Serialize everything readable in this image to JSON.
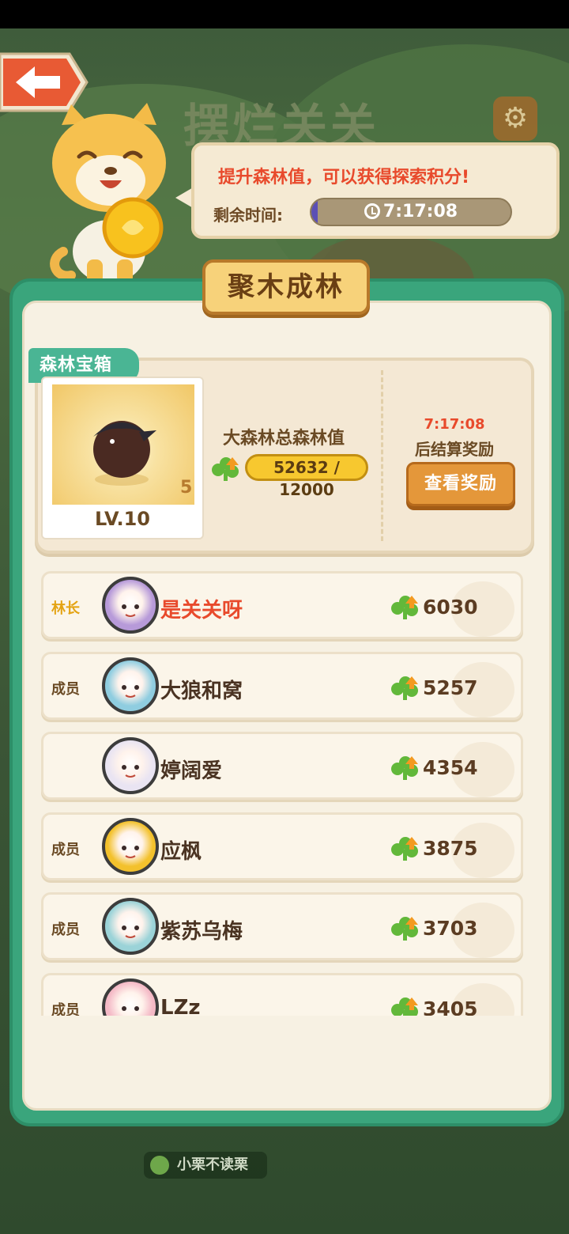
{
  "header": {
    "game_title": "摆烂关关",
    "settings_icon": "gear-icon",
    "back_icon": "arrow-left-icon"
  },
  "bubble": {
    "tip": "提升森林值，可以获得探索积分!",
    "remaining_label": "剩余时间:",
    "remaining_time": "7:17:08",
    "remaining_fraction": 0.03
  },
  "panel": {
    "title": "聚木成林"
  },
  "chest": {
    "tag": "森林宝箱",
    "count": "5",
    "level": "LV.10",
    "forest_total_label": "大森林总森林值",
    "forest_progress": "52632 / 12000",
    "settle_time": "7:17:08",
    "settle_label": "后结算奖励",
    "reward_button": "查看奖励"
  },
  "members": [
    {
      "role": "林长",
      "name": "是关关呀",
      "score": "6030",
      "is_leader": true,
      "avatar_color": "#b79ad9"
    },
    {
      "role": "成员",
      "name": "大狼和窝",
      "score": "5257",
      "is_leader": false,
      "avatar_color": "#8fcde0"
    },
    {
      "role": "",
      "name": "婷阔爱",
      "score": "4354",
      "is_leader": false,
      "avatar_color": "#e9e4f2"
    },
    {
      "role": "成员",
      "name": "应枫",
      "score": "3875",
      "is_leader": false,
      "avatar_color": "#f3c12c"
    },
    {
      "role": "成员",
      "name": "紫苏乌梅",
      "score": "3703",
      "is_leader": false,
      "avatar_color": "#9bd3d8"
    },
    {
      "role": "成员",
      "name": "LZz",
      "score": "3405",
      "is_leader": false,
      "avatar_color": "#f4b9c6"
    }
  ],
  "footer": {
    "tag": "小栗不读栗"
  },
  "colors": {
    "panel_green": "#3aa57c",
    "accent_red": "#e84a2c",
    "button_orange": "#e4973a"
  }
}
